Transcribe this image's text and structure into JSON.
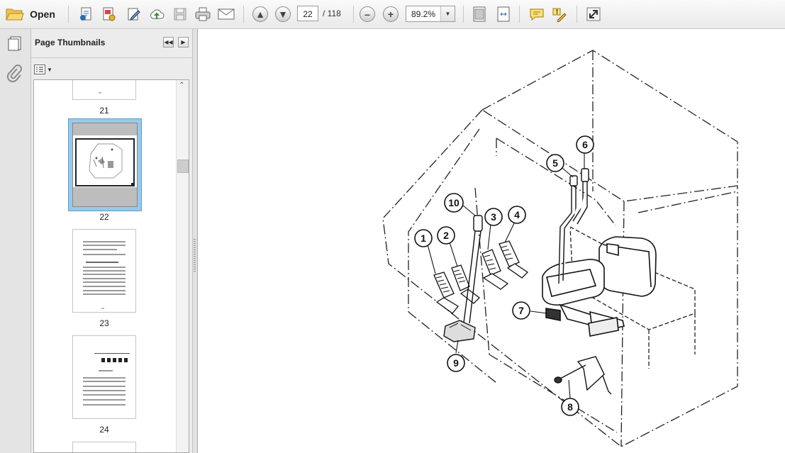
{
  "toolbar": {
    "open_label": "Open",
    "page_current": "22",
    "page_total": "/ 118",
    "zoom": "89.2%",
    "icons": [
      "folder-open-icon",
      "create-pdf-icon",
      "pdf-settings-icon",
      "edit-icon",
      "upload-icon",
      "save-icon",
      "print-icon",
      "email-icon",
      "prev-page-icon",
      "next-page-icon",
      "zoom-out-icon",
      "zoom-in-icon",
      "fit-page-icon",
      "fit-width-icon",
      "comment-icon",
      "highlight-icon",
      "fullscreen-icon"
    ]
  },
  "panel": {
    "title": "Page Thumbnails",
    "thumbnails": [
      {
        "label": "21"
      },
      {
        "label": "22",
        "selected": true
      },
      {
        "label": "23"
      },
      {
        "label": "24"
      }
    ]
  },
  "diagram": {
    "callouts": [
      "1",
      "2",
      "3",
      "4",
      "5",
      "6",
      "7",
      "8",
      "9",
      "10"
    ]
  },
  "colors": {
    "selection_blue": "#99c9e8",
    "toolbar_bg": "#ececec",
    "panel_bg": "#e4e4e4"
  }
}
